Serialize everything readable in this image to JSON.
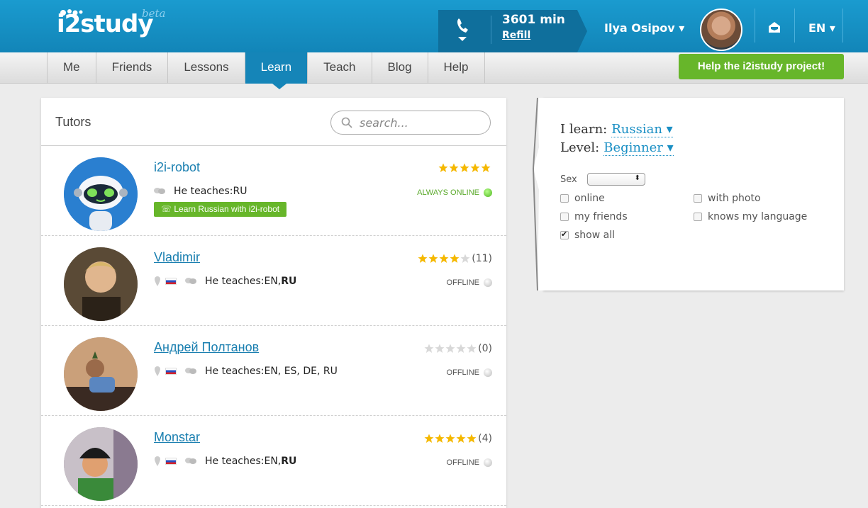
{
  "header": {
    "logo_text": "i2study",
    "logo_beta": "beta",
    "minutes": "3601 min",
    "refill": "Refill",
    "user_name": "Ilya Osipov ▾",
    "language": "EN ▾"
  },
  "nav": {
    "tabs": [
      {
        "label": "Me"
      },
      {
        "label": "Friends"
      },
      {
        "label": "Lessons"
      },
      {
        "label": "Learn"
      },
      {
        "label": "Teach"
      },
      {
        "label": "Blog"
      },
      {
        "label": "Help"
      }
    ],
    "active": "Learn",
    "help_button": "Help the i2istudy project!"
  },
  "tutors": {
    "title": "Tutors",
    "search_placeholder": "search...",
    "items": [
      {
        "name": "i2i-robot",
        "teaches_prefix": "He teaches: ",
        "teaches": "RU",
        "teaches_bold": "",
        "rating_text": "",
        "stars_filled": 5,
        "status": "ALWAYS ONLINE",
        "learn_button": "Learn Russian with i2i-robot"
      },
      {
        "name": "Vladimir",
        "teaches_prefix": "He teaches: ",
        "teaches": "EN, ",
        "teaches_bold": "RU",
        "rating_text": "(11)",
        "stars_filled": 4,
        "status": "OFFLINE"
      },
      {
        "name": "Андрей Полтанов",
        "teaches_prefix": "He teaches: ",
        "teaches": "EN, ES, DE, RU",
        "teaches_bold": "",
        "rating_text": "(0)",
        "stars_filled": 0,
        "status": "OFFLINE"
      },
      {
        "name": "Monstar",
        "teaches_prefix": "He teaches: ",
        "teaches": "EN, ",
        "teaches_bold": "RU",
        "rating_text": "(4)",
        "stars_filled": 5,
        "status": "OFFLINE"
      }
    ]
  },
  "filters": {
    "learn_label": "I learn:",
    "learn_value": "Russian ▾",
    "level_label": "Level:",
    "level_value": "Beginner ▾",
    "sex_label": "Sex",
    "sex_value": "",
    "checkboxes": [
      {
        "label": "online",
        "checked": false
      },
      {
        "label": "with photo",
        "checked": false
      },
      {
        "label": "my friends",
        "checked": false
      },
      {
        "label": "knows my language",
        "checked": false
      },
      {
        "label": "show all",
        "checked": true
      }
    ]
  },
  "colors": {
    "header_blue": "#1a9bcf",
    "active_tab": "#1585b8",
    "green": "#67b62a",
    "link_blue": "#1a7fb0",
    "star_gold": "#f5b800",
    "online_green": "#6cc72e"
  }
}
